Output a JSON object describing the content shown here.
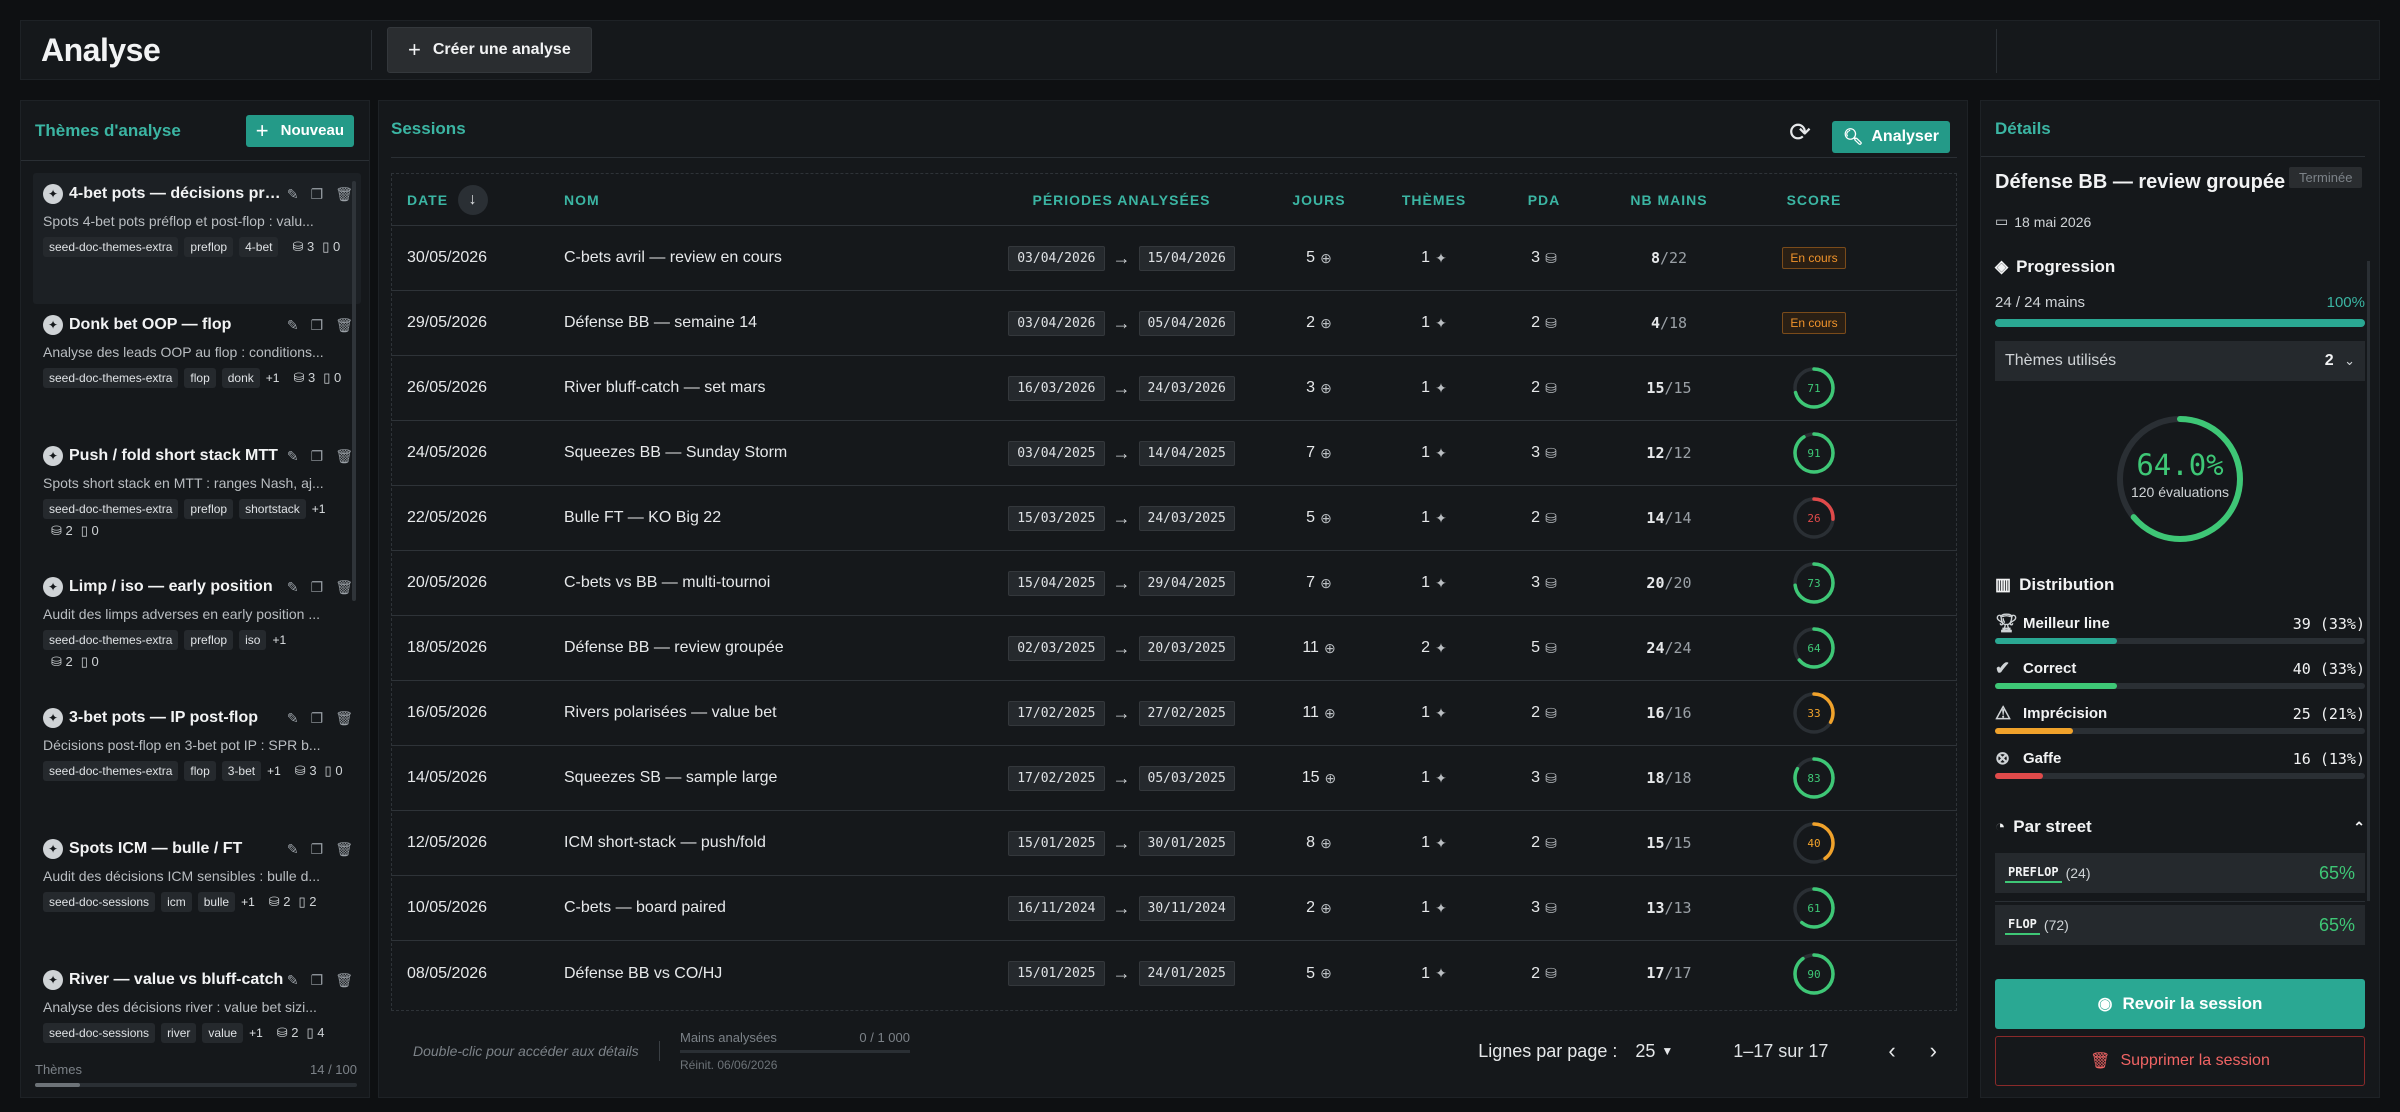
{
  "header": {
    "title": "Analyse",
    "create_label": "Créer une analyse"
  },
  "themes_panel": {
    "title": "Thèmes d'analyse",
    "new_label": "Nouveau",
    "footer_label": "Thèmes",
    "footer_count": "14 / 100",
    "items": [
      {
        "title": "4-bet pots — décisions préflop et post-flop",
        "desc": "Spots 4-bet pots préflop et post-flop : valu...",
        "tags": [
          "seed-doc-themes-extra",
          "preflop",
          "4-bet"
        ],
        "extra": "",
        "sessions": "3",
        "count": "0"
      },
      {
        "title": "Donk bet OOP — flop",
        "desc": "Analyse des leads OOP au flop : conditions...",
        "tags": [
          "seed-doc-themes-extra",
          "flop",
          "donk"
        ],
        "extra": "+1",
        "sessions": "3",
        "count": "0"
      },
      {
        "title": "Push / fold short stack MTT",
        "desc": "Spots short stack en MTT : ranges Nash, aj...",
        "tags": [
          "seed-doc-themes-extra",
          "preflop",
          "shortstack"
        ],
        "extra": "+1",
        "sessions": "2",
        "count": "0"
      },
      {
        "title": "Limp / iso — early position",
        "desc": "Audit des limps adverses en early position ...",
        "tags": [
          "seed-doc-themes-extra",
          "preflop",
          "iso"
        ],
        "extra": "+1",
        "sessions": "2",
        "count": "0"
      },
      {
        "title": "3-bet pots — IP post-flop",
        "desc": "Décisions post-flop en 3-bet pot IP : SPR b...",
        "tags": [
          "seed-doc-themes-extra",
          "flop",
          "3-bet"
        ],
        "extra": "+1",
        "sessions": "3",
        "count": "0"
      },
      {
        "title": "Spots ICM — bulle / FT",
        "desc": "Audit des décisions ICM sensibles : bulle d...",
        "tags": [
          "seed-doc-sessions",
          "icm",
          "bulle"
        ],
        "extra": "+1",
        "sessions": "2",
        "count": "2"
      },
      {
        "title": "River — value vs bluff-catch",
        "desc": "Analyse des décisions river : value bet sizi...",
        "tags": [
          "seed-doc-sessions",
          "river",
          "value"
        ],
        "extra": "+1",
        "sessions": "2",
        "count": "4"
      }
    ]
  },
  "sessions": {
    "title": "Sessions",
    "analyze_label": "Analyser",
    "columns": {
      "date": "DATE",
      "name": "NOM",
      "periods": "PÉRIODES ANALYSÉES",
      "days": "JOURS",
      "themes": "THÈMES",
      "pda": "PDA",
      "hands": "NB MAINS",
      "score": "SCORE"
    },
    "rows": [
      {
        "date": "30/05/2026",
        "name": "C-bets avril — review en cours",
        "from": "03/04/2026",
        "to": "15/04/2026",
        "days": "5",
        "themes": "1",
        "pda": "3",
        "hands": "8",
        "total": "/22",
        "score_label": "En cours",
        "score": null
      },
      {
        "date": "29/05/2026",
        "name": "Défense BB — semaine 14",
        "from": "03/04/2026",
        "to": "05/04/2026",
        "days": "2",
        "themes": "1",
        "pda": "2",
        "hands": "4",
        "total": "/18",
        "score_label": "En cours",
        "score": null
      },
      {
        "date": "26/05/2026",
        "name": "River bluff-catch — set mars",
        "from": "16/03/2026",
        "to": "24/03/2026",
        "days": "3",
        "themes": "1",
        "pda": "2",
        "hands": "15",
        "total": "/15",
        "score_label": "71",
        "score": 71
      },
      {
        "date": "24/05/2026",
        "name": "Squeezes BB — Sunday Storm",
        "from": "03/04/2025",
        "to": "14/04/2025",
        "days": "7",
        "themes": "1",
        "pda": "3",
        "hands": "12",
        "total": "/12",
        "score_label": "91",
        "score": 91
      },
      {
        "date": "22/05/2026",
        "name": "Bulle FT — KO Big 22",
        "from": "15/03/2025",
        "to": "24/03/2025",
        "days": "5",
        "themes": "1",
        "pda": "2",
        "hands": "14",
        "total": "/14",
        "score_label": "26",
        "score": 26
      },
      {
        "date": "20/05/2026",
        "name": "C-bets vs BB — multi-tournoi",
        "from": "15/04/2025",
        "to": "29/04/2025",
        "days": "7",
        "themes": "1",
        "pda": "3",
        "hands": "20",
        "total": "/20",
        "score_label": "73",
        "score": 73
      },
      {
        "date": "18/05/2026",
        "name": "Défense BB — review groupée",
        "from": "02/03/2025",
        "to": "20/03/2025",
        "days": "11",
        "themes": "2",
        "pda": "5",
        "hands": "24",
        "total": "/24",
        "score_label": "64",
        "score": 64
      },
      {
        "date": "16/05/2026",
        "name": "Rivers polarisées — value bet",
        "from": "17/02/2025",
        "to": "27/02/2025",
        "days": "11",
        "themes": "1",
        "pda": "2",
        "hands": "16",
        "total": "/16",
        "score_label": "33",
        "score": 33
      },
      {
        "date": "14/05/2026",
        "name": "Squeezes SB — sample large",
        "from": "17/02/2025",
        "to": "05/03/2025",
        "days": "15",
        "themes": "1",
        "pda": "3",
        "hands": "18",
        "total": "/18",
        "score_label": "83",
        "score": 83
      },
      {
        "date": "12/05/2026",
        "name": "ICM short-stack — push/fold",
        "from": "15/01/2025",
        "to": "30/01/2025",
        "days": "8",
        "themes": "1",
        "pda": "2",
        "hands": "15",
        "total": "/15",
        "score_label": "40",
        "score": 40
      },
      {
        "date": "10/05/2026",
        "name": "C-bets — board paired",
        "from": "16/11/2024",
        "to": "30/11/2024",
        "days": "2",
        "themes": "1",
        "pda": "3",
        "hands": "13",
        "total": "/13",
        "score_label": "61",
        "score": 61
      },
      {
        "date": "08/05/2026",
        "name": "Défense BB vs CO/HJ",
        "from": "15/01/2025",
        "to": "24/01/2025",
        "days": "5",
        "themes": "1",
        "pda": "2",
        "hands": "17",
        "total": "/17",
        "score_label": "90",
        "score": 90
      }
    ],
    "footer": {
      "hint": "Double-clic pour accéder aux détails",
      "hands_label": "Mains analysées",
      "hands_value": "0 / 1 000",
      "reset": "Réinit. 06/06/2026",
      "rows_per_page_label": "Lignes par page :",
      "rows_per_page": "25",
      "range": "1–17 sur 17"
    }
  },
  "details": {
    "title": "Détails",
    "session_title": "Défense BB — review groupée",
    "status": "Terminée",
    "date": "18 mai 2026",
    "progression_label": "Progression",
    "hands_progress": "24 / 24 mains",
    "progress_pct_label": "100%",
    "progress": 1.0,
    "themes_used_label": "Thèmes utilisés",
    "themes_used": "2",
    "score_pct": "64.0%",
    "score_fraction": 0.64,
    "evaluations": "120 évaluations",
    "distribution_label": "Distribution",
    "distribution": [
      {
        "label": "Meilleur line",
        "value": "39 (33%)",
        "fraction": 0.33,
        "color": "#2aa893"
      },
      {
        "label": "Correct",
        "value": "40 (33%)",
        "fraction": 0.33,
        "color": "#3ec776"
      },
      {
        "label": "Imprécision",
        "value": "25 (21%)",
        "fraction": 0.21,
        "color": "#f0a22b"
      },
      {
        "label": "Gaffe",
        "value": "16 (13%)",
        "fraction": 0.13,
        "color": "#e04a4a"
      }
    ],
    "street_label": "Par street",
    "streets": [
      {
        "tag": "PREFLOP",
        "count": "(24)",
        "pct": "65%"
      },
      {
        "tag": "FLOP",
        "count": "(72)",
        "pct": "65%"
      }
    ],
    "review_label": "Revoir la session",
    "delete_label": "Supprimer la session"
  }
}
